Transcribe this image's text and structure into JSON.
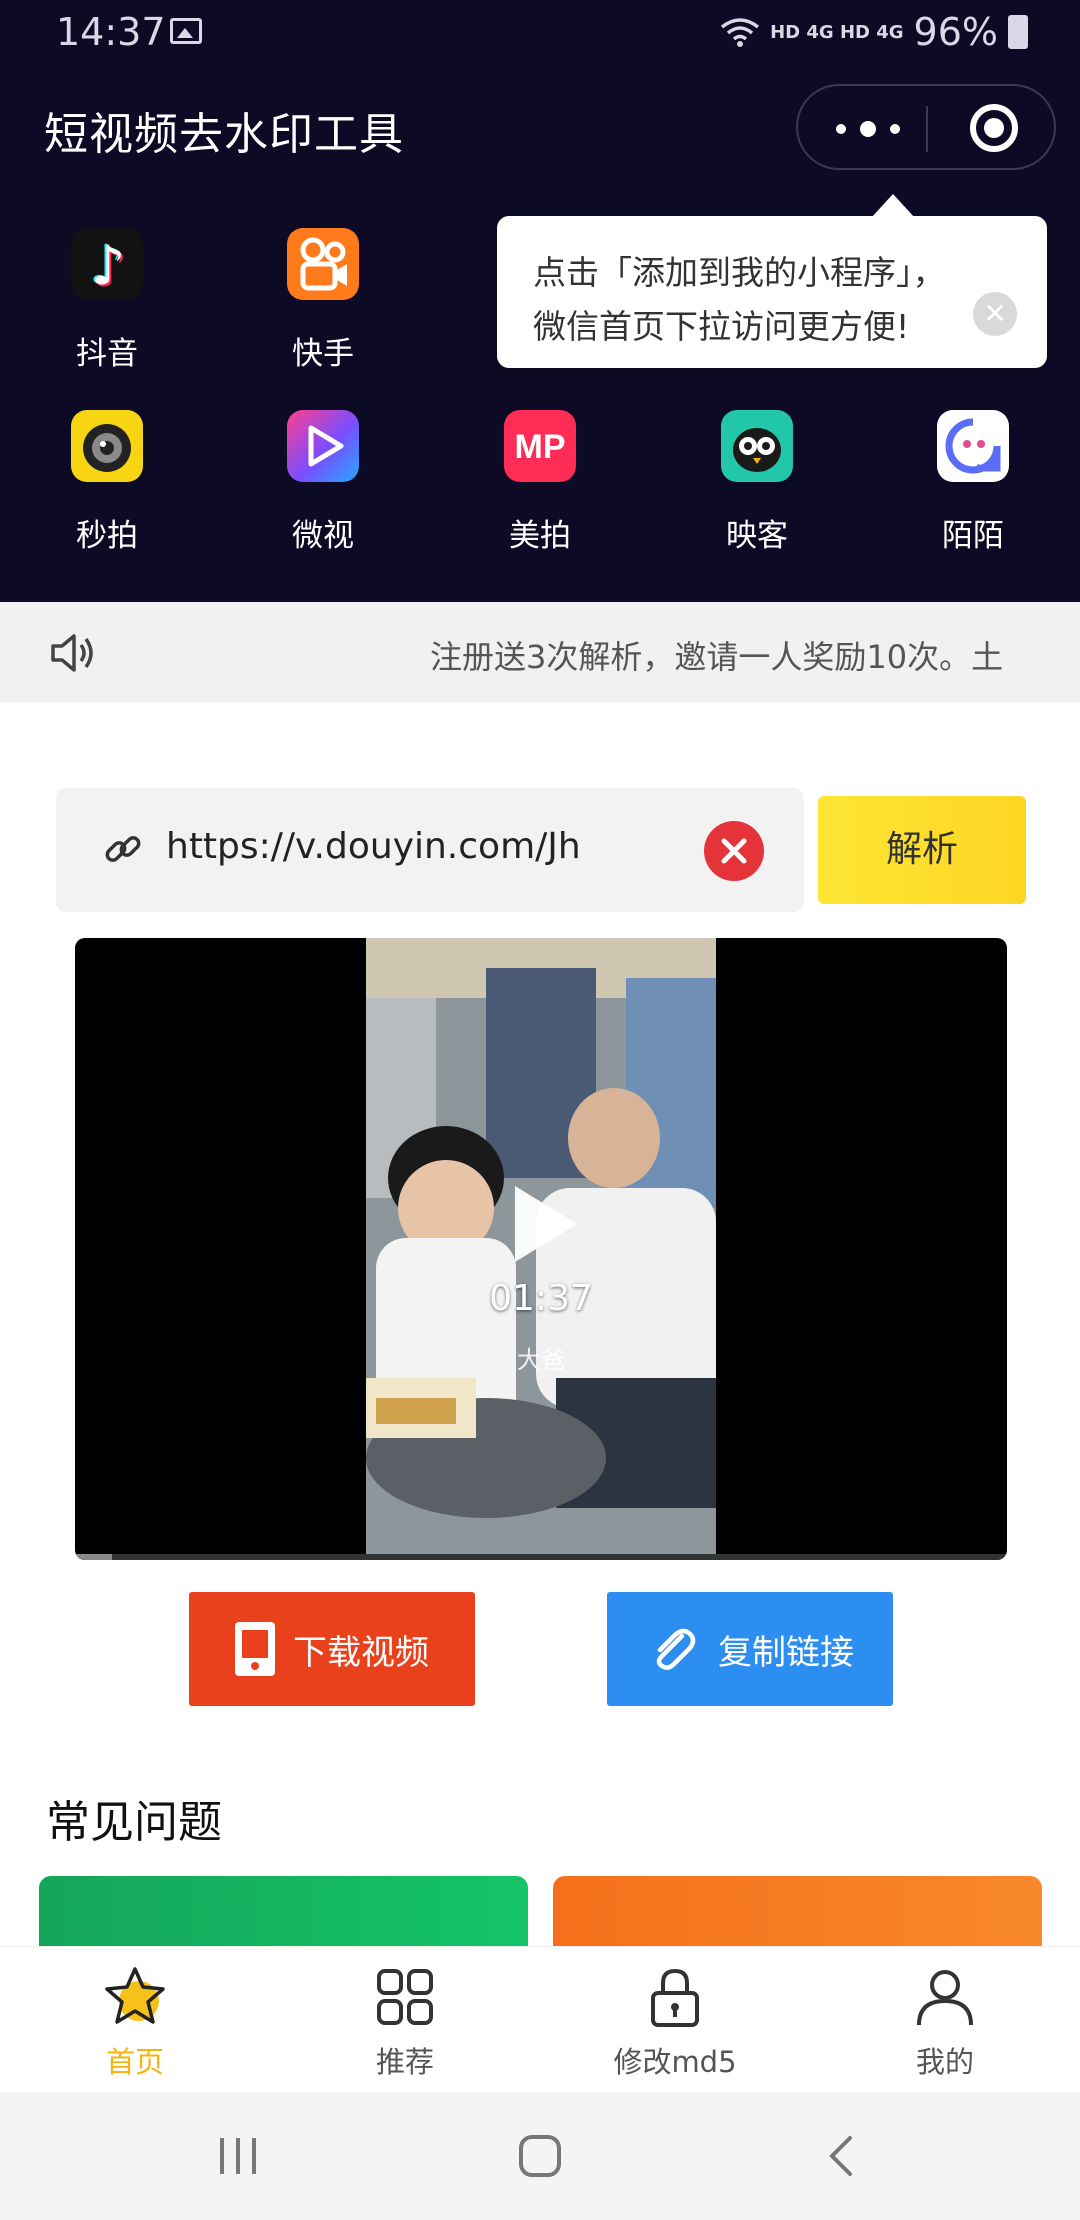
{
  "status_bar": {
    "time": "14:37",
    "network": "HD 4G HD 4G",
    "battery": "96%"
  },
  "header": {
    "title": "短视频去水印工具",
    "menu_icon": "more-dots-icon",
    "close_icon": "target-circle-icon"
  },
  "tooltip": {
    "line1": "点击「添加到我的小程序」，",
    "line2": "微信首页下拉访问更方便!",
    "close_icon": "close-icon"
  },
  "platforms": [
    {
      "label": "抖音",
      "icon": "douyin-icon"
    },
    {
      "label": "快手",
      "icon": "kuaishou-icon"
    },
    {
      "label": "秒拍",
      "icon": "miaopai-icon"
    },
    {
      "label": "微视",
      "icon": "weishi-icon"
    },
    {
      "label": "美拍",
      "icon": "meipai-icon"
    },
    {
      "label": "映客",
      "icon": "yingke-icon"
    },
    {
      "label": "陌陌",
      "icon": "momo-icon"
    }
  ],
  "notice": {
    "icon": "speaker-icon",
    "text": "注册送3次解析，邀请一人奖励10次。土"
  },
  "url_input": {
    "value": "https://v.douyin.com/Jh",
    "icon": "link-icon",
    "clear_icon": "clear-icon"
  },
  "parse_button": "解析",
  "video": {
    "duration": "01:37",
    "caption": "大爸",
    "progress": 0.04
  },
  "actions": {
    "download": "下载视频",
    "copy": "复制链接"
  },
  "faq": {
    "title": "常见问题"
  },
  "tabs": [
    {
      "label": "首页",
      "icon": "star-icon",
      "active": true
    },
    {
      "label": "推荐",
      "icon": "grid-icon",
      "active": false
    },
    {
      "label": "修改md5",
      "icon": "lock-icon",
      "active": false
    },
    {
      "label": "我的",
      "icon": "person-icon",
      "active": false
    }
  ],
  "colors": {
    "header_bg": "#0d0a26",
    "parse_button": "#fdd623",
    "download_button": "#e9411b",
    "copy_button": "#2c8ef0",
    "active_tab": "#f6b40e"
  }
}
